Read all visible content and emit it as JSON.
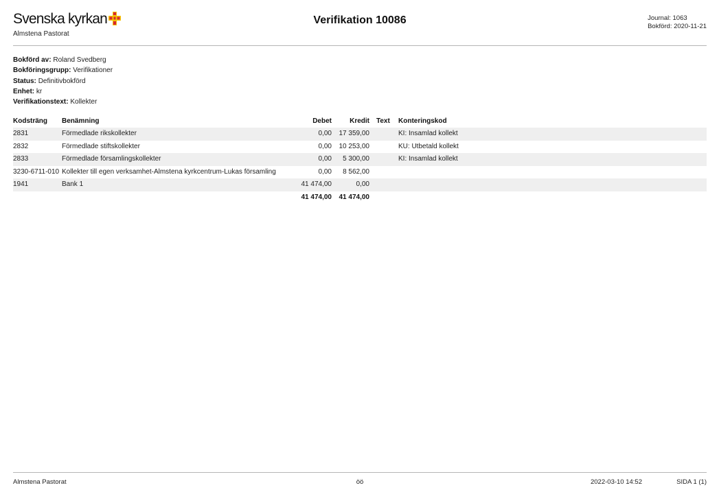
{
  "header": {
    "logo_text": "Svenska kyrkan",
    "organization": "Almstena Pastorat",
    "title": "Verifikation 10086",
    "journal": "Journal: 1063",
    "bokford": "Bokförd: 2020-11-21",
    "colors": {
      "cross_yellow": "#F4C300",
      "cross_red": "#D7282F"
    }
  },
  "info": [
    {
      "key": "Bokförd av:",
      "value": "Roland Svedberg"
    },
    {
      "key": "Bokföringsgrupp:",
      "value": "Verifikationer"
    },
    {
      "key": "Status:",
      "value": "Definitivbokförd"
    },
    {
      "key": "Enhet:",
      "value": "kr"
    },
    {
      "key": "Verifikationstext:",
      "value": "Kollekter"
    }
  ],
  "table": {
    "columns": {
      "kodstrang": "Kodsträng",
      "benamning": "Benämning",
      "debet": "Debet",
      "kredit": "Kredit",
      "text": "Text",
      "konteringskod": "Konteringskod"
    },
    "rows": [
      {
        "kodstrang": "2831",
        "benamning": "Förmedlade rikskollekter",
        "debet": "0,00",
        "kredit": "17 359,00",
        "text": "",
        "konteringskod": "KI: Insamlad kollekt"
      },
      {
        "kodstrang": "2832",
        "benamning": "Förmedlade stiftskollekter",
        "debet": "0,00",
        "kredit": "10 253,00",
        "text": "",
        "konteringskod": "KU: Utbetald kollekt"
      },
      {
        "kodstrang": "2833",
        "benamning": "Förmedlade församlingskollekter",
        "debet": "0,00",
        "kredit": "5 300,00",
        "text": "",
        "konteringskod": "KI: Insamlad kollekt"
      },
      {
        "kodstrang": "3230-6711-010",
        "benamning": "Kollekter till egen verksamhet-Almstena kyrkcentrum-Lukas församling",
        "debet": "0,00",
        "kredit": "8 562,00",
        "text": "",
        "konteringskod": ""
      },
      {
        "kodstrang": "1941",
        "benamning": "Bank 1",
        "debet": "41 474,00",
        "kredit": "0,00",
        "text": "",
        "konteringskod": ""
      }
    ],
    "totals": {
      "debet": "41 474,00",
      "kredit": "41 474,00"
    }
  },
  "footer": {
    "organization": "Almstena Pastorat",
    "center": "öö",
    "datetime": "2022-03-10 14:52",
    "page": "SIDA 1 (1)"
  }
}
